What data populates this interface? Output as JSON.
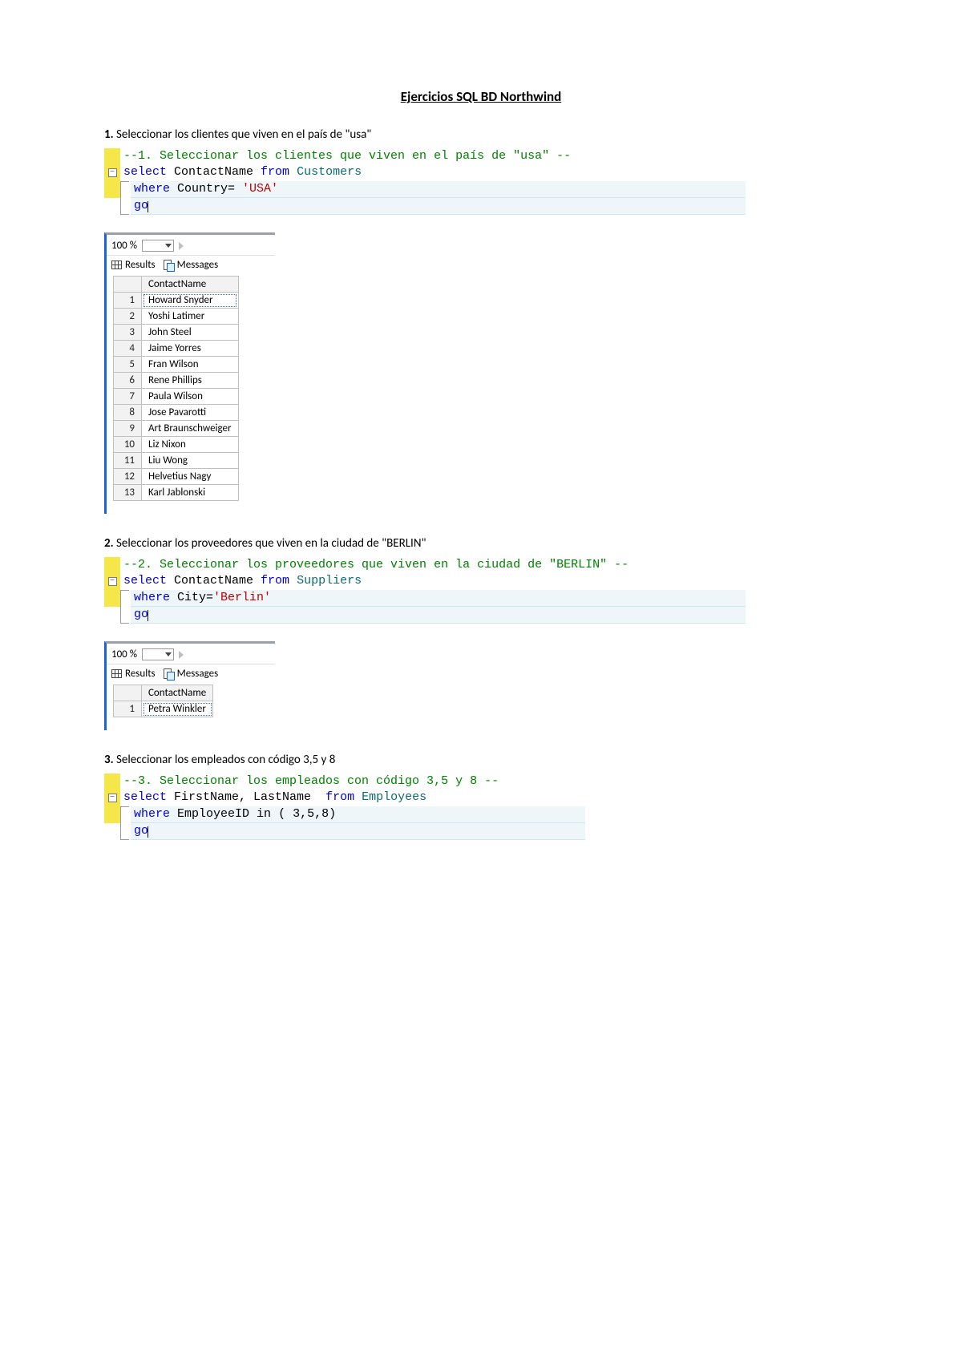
{
  "title": "Ejercicios SQL BD Northwind",
  "q1": {
    "prompt_num": "1. ",
    "prompt_text": "Seleccionar los clientes que viven en el país de \"usa\"",
    "code": {
      "comment": "--1. Seleccionar los clientes que viven en el país de \"usa\" --",
      "l2_a": "select",
      "l2_b": " ContactName ",
      "l2_c": "from",
      "l2_d": " Customers",
      "l3_a": "where",
      "l3_b": " Country",
      "l3_c": "=",
      "l3_d": " 'USA'",
      "l4": "go"
    },
    "zoom": "100 %",
    "tab_results": "Results",
    "tab_messages": "Messages",
    "col": "ContactName",
    "rows": [
      "Howard Snyder",
      "Yoshi Latimer",
      "John Steel",
      "Jaime Yorres",
      "Fran Wilson",
      "Rene Phillips",
      "Paula Wilson",
      "Jose Pavarotti",
      "Art Braunschweiger",
      "Liz Nixon",
      "Liu Wong",
      "Helvetius Nagy",
      "Karl Jablonski"
    ]
  },
  "q2": {
    "prompt_num": "2. ",
    "prompt_text": "Seleccionar los proveedores que viven en la ciudad de \"BERLIN\"",
    "code": {
      "comment": "--2. Seleccionar los proveedores que viven en la ciudad de \"BERLIN\" --",
      "l2_a": "select",
      "l2_b": " ContactName ",
      "l2_c": "from",
      "l2_d": " Suppliers",
      "l3_a": "where",
      "l3_b": " City",
      "l3_c": "=",
      "l3_d": "'Berlin'",
      "l4": "go"
    },
    "zoom": "100 %",
    "tab_results": "Results",
    "tab_messages": "Messages",
    "col": "ContactName",
    "rows": [
      "Petra Winkler"
    ]
  },
  "q3": {
    "prompt_num": "3. ",
    "prompt_text": "Seleccionar los empleados con código 3,5 y 8",
    "code": {
      "comment": "--3. Seleccionar los empleados con código 3,5 y 8 --",
      "l2_a": "select",
      "l2_b": " FirstName",
      "l2_c": ",",
      "l2_d": " LastName  ",
      "l2_e": "from",
      "l2_f": " Employees",
      "l3_a": "where",
      "l3_b": " EmployeeID ",
      "l3_c": "in",
      "l3_d": " (",
      "l3_e": " 3",
      "l3_f": ",",
      "l3_g": "5",
      "l3_h": ",",
      "l3_i": "8",
      "l3_j": ")",
      "l4": "go"
    }
  },
  "nums": {
    "1": "1",
    "2": "2",
    "3": "3",
    "4": "4",
    "5": "5",
    "6": "6",
    "7": "7",
    "8": "8",
    "9": "9",
    "10": "10",
    "11": "11",
    "12": "12",
    "13": "13"
  }
}
